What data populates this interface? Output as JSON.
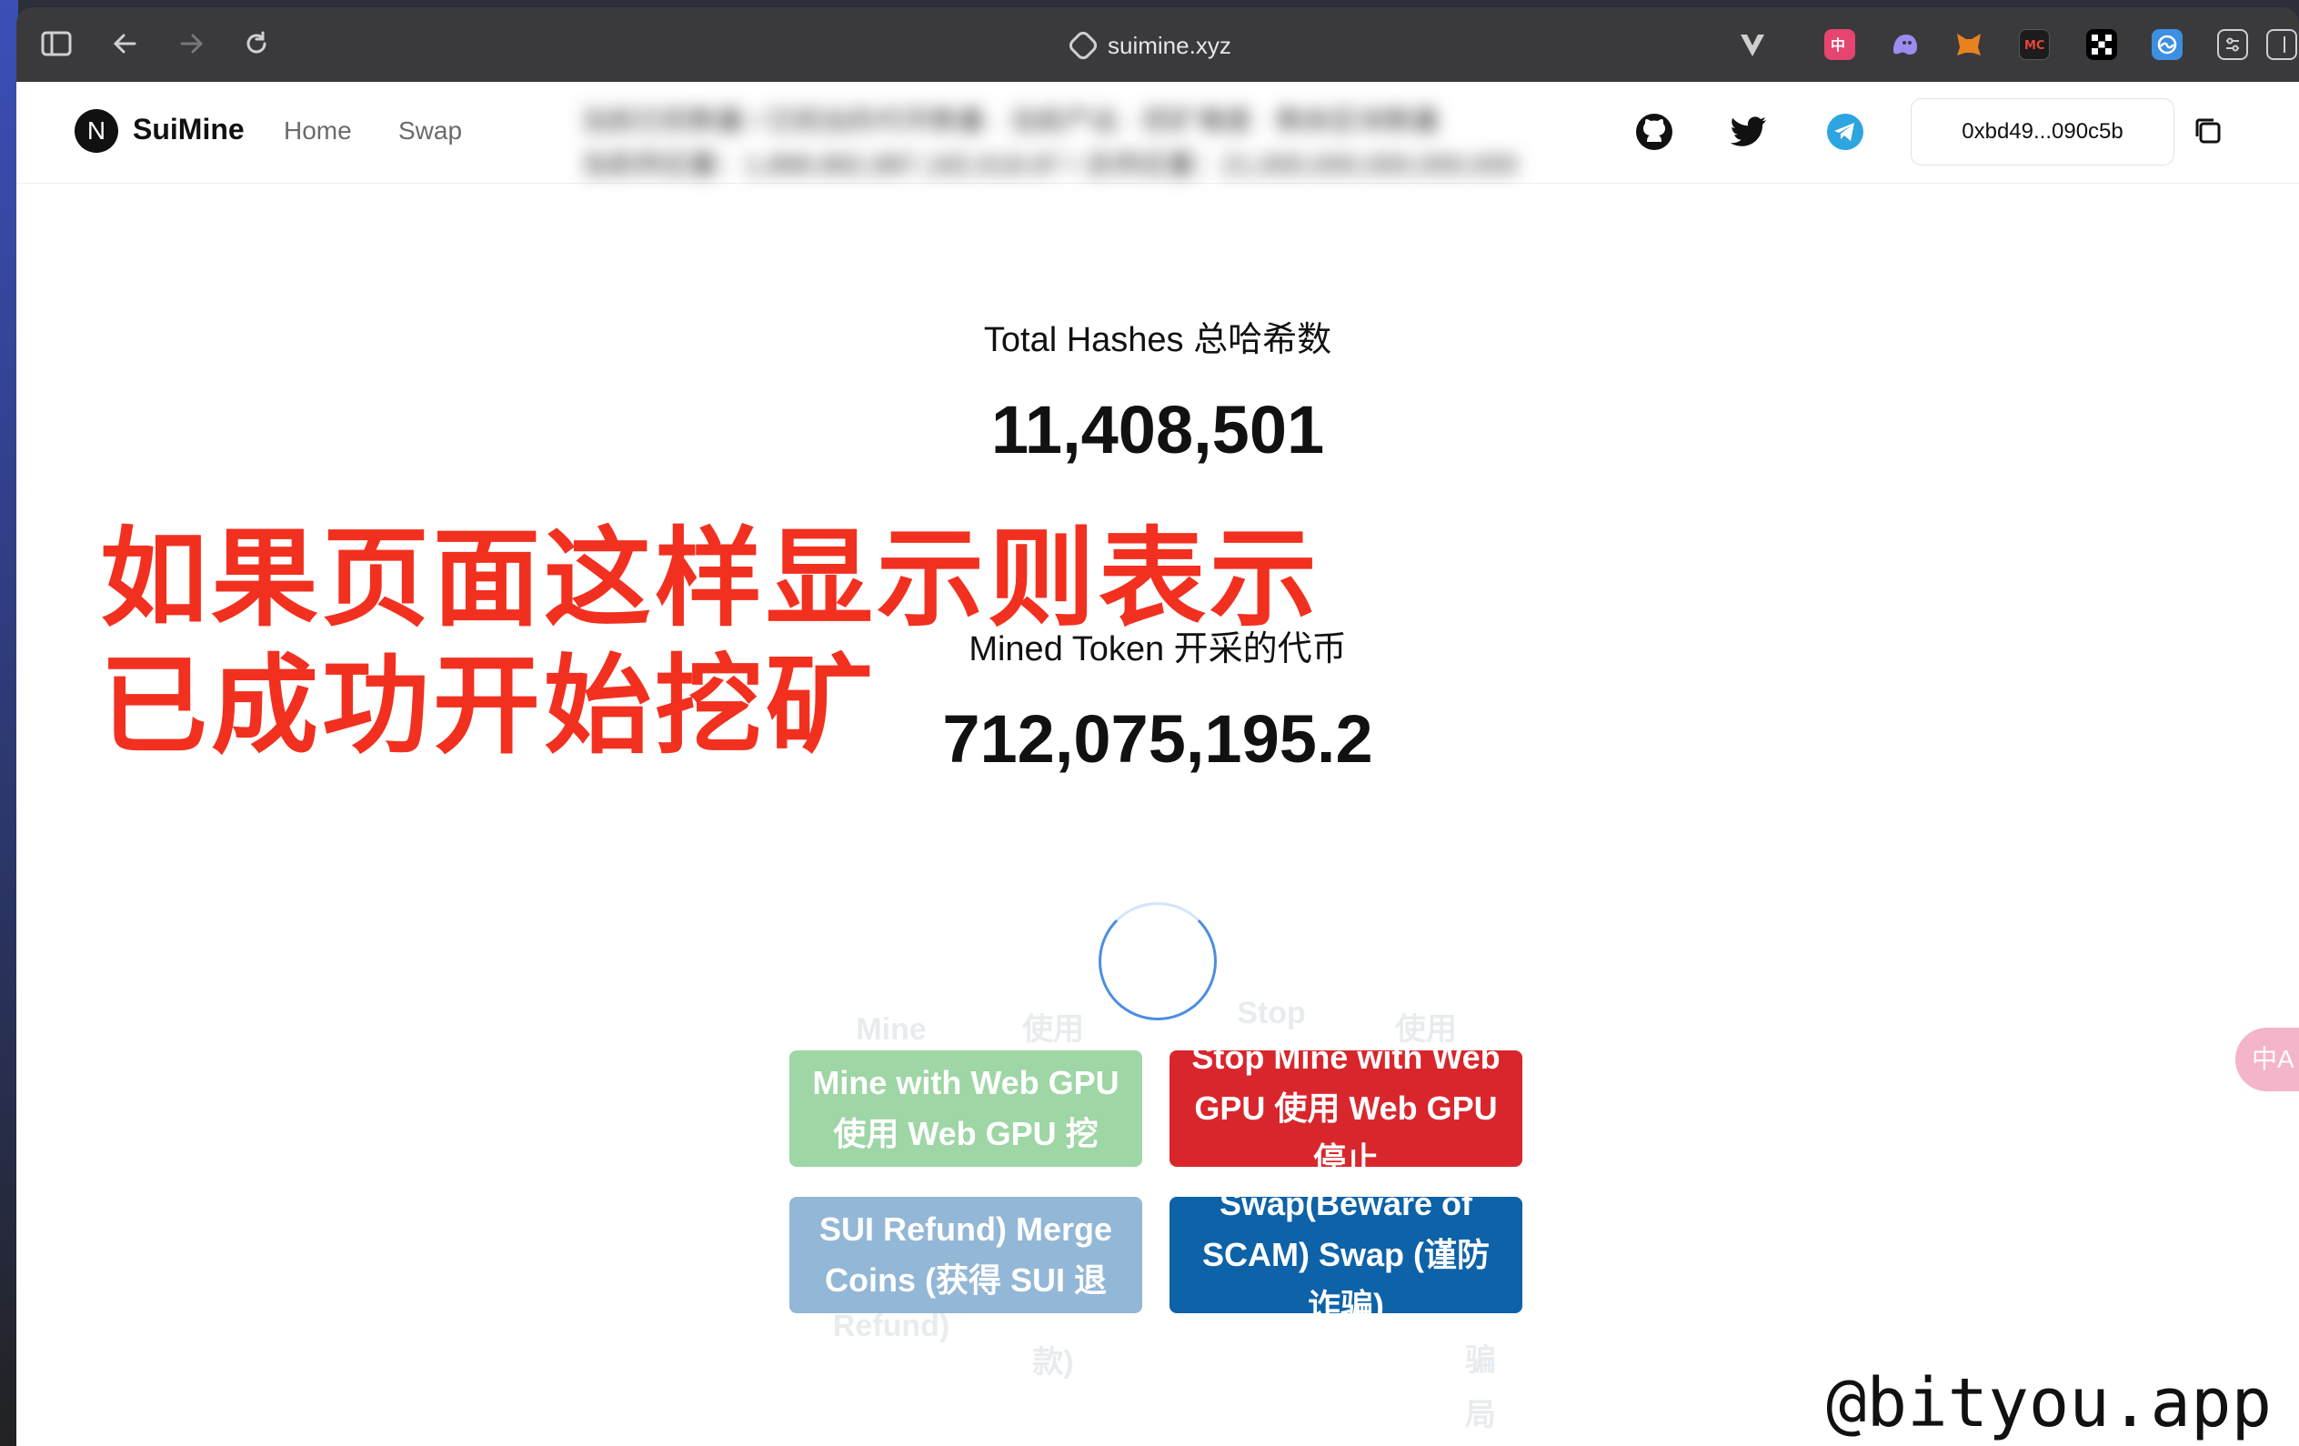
{
  "browser": {
    "url": "suimine.xyz",
    "ext_icons": [
      "vivaldi-v-icon",
      "translate-ext-icon",
      "ghost-ext-icon",
      "metamask-icon",
      "mc-ext-icon",
      "okx-icon",
      "wave-ext-icon",
      "settings-ext-icon"
    ]
  },
  "nav": {
    "logo_letter": "N",
    "brand": "SuiMine",
    "links": [
      "Home",
      "Swap"
    ],
    "blurred_line1": "当前已挖数量 / 已挖出的代币数量 · 当前产出 · 挖矿难度 · 剩余区块数量",
    "blurred_line2": "当前供应量：1,888,882,887,182,618.87 / 总供应量：21,000,000,000,000,000",
    "wallet": "0xbd49...090c5b"
  },
  "stats": {
    "total_hashes_label": "Total Hashes 总哈希数",
    "total_hashes_value": "11,408,501",
    "mined_label": "Mined Token 开采的代币",
    "mined_value": "712,075,195.2"
  },
  "overlay": {
    "line1": "如果页面这样显示则表示",
    "line2": "已成功开始挖矿",
    "color": "#f2301f"
  },
  "buttons": {
    "mine_label": "Mine with Web GPU 使用 Web GPU 挖",
    "stop_label": "Stop Mine with Web GPU 使用 Web GPU 停止",
    "merge_label": "Merge Coins(Get SUI Refund) Merge Coins (获得 SUI 退款)",
    "swap_label": "Swap(Beware of SCAM) Swap (谨防诈骗)",
    "mine_color": "#9ed6a5",
    "stop_color": "#d9262c",
    "merge_color": "#93b7d6",
    "swap_color": "#0d62a8"
  },
  "ghost_text": {
    "mine_top": "Mine",
    "mine_top2": "使用",
    "stop_top": "Stop",
    "stop_top2": "使用",
    "merge_bottom": "Refund)",
    "merge_bottom2": "款)",
    "swap_bottom": "骗局"
  },
  "translate_widget": "中A",
  "watermark": "@bityou.app"
}
